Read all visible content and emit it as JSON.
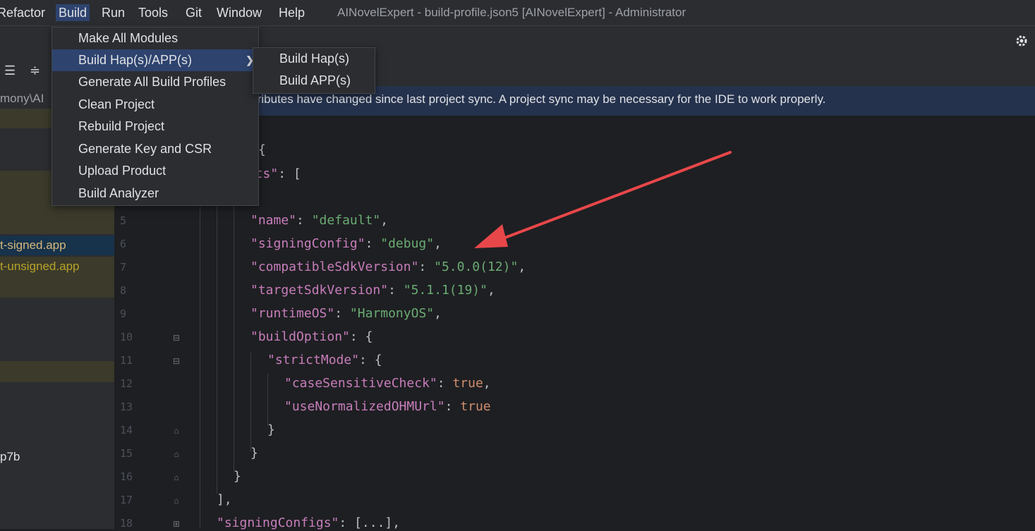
{
  "menubar": {
    "items": [
      "Refactor",
      "Build",
      "Run",
      "Tools",
      "Git",
      "Window",
      "Help"
    ],
    "window_title": "AINovelExpert - build-profile.json5 [AINovelExpert] - Administrator"
  },
  "toolbar": {
    "settings_icon": "gear-icon"
  },
  "project_panel": {
    "path_fragment": "mony\\AI",
    "rows": [
      {
        "label": "t-signed.app",
        "color": "#d5b77a",
        "bg": "#17324b"
      },
      {
        "label": "t-unsigned.app",
        "color": "#b7a227",
        "bg": "#3b3a2b"
      },
      {
        "label": "p7b",
        "color": "#dfe1e5",
        "bg": ""
      }
    ]
  },
  "banner": {
    "text": "tributes have changed since last project sync. A project sync may be necessary for the IDE to work properly."
  },
  "build_menu": {
    "items": [
      "Make All Modules",
      "Build Hap(s)/APP(s)",
      "Generate All Build Profiles",
      "Clean Project",
      "Rebuild Project",
      "Generate Key and CSR",
      "Upload Product",
      "Build Analyzer"
    ],
    "selected_index": 1,
    "submenu": [
      "Build Hap(s)",
      "Build APP(s)"
    ]
  },
  "editor": {
    "line_numbers": [
      "5",
      "6",
      "7",
      "8",
      "9",
      "10",
      "11",
      "12",
      "13",
      "14",
      "15",
      "16",
      "17",
      "18"
    ],
    "lines": [
      {
        "key": "\"name\"",
        "val": "\"default\"",
        "suffix": ","
      },
      {
        "key": "\"signingConfig\"",
        "val": "\"debug\"",
        "suffix": ","
      },
      {
        "key": "\"compatibleSdkVersion\"",
        "val": "\"5.0.0(12)\"",
        "suffix": ","
      },
      {
        "key": "\"targetSdkVersion\"",
        "val": "\"5.1.1(19)\"",
        "suffix": ","
      },
      {
        "key": "\"runtimeOS\"",
        "val": "\"HarmonyOS\"",
        "suffix": ","
      },
      {
        "key": "\"buildOption\"",
        "val": "",
        "suffix": ": {"
      },
      {
        "key": "\"strictMode\"",
        "val": "",
        "suffix": ": {"
      },
      {
        "key": "\"caseSensitiveCheck\"",
        "val": "true",
        "suffix": ","
      },
      {
        "key": "\"useNormalizedOHMUrl\"",
        "val": "true",
        "suffix": ""
      }
    ],
    "top_brace": "{",
    "products_key_fragment": "ucts\"",
    "products_suffix": ": [",
    "close1": "}",
    "close2": "}",
    "close3": "}",
    "close_array": "],",
    "signing_key": "\"signingConfigs\"",
    "signing_suffix": ": [...],"
  },
  "annotation": {
    "arrow_color": "#e8474a"
  }
}
